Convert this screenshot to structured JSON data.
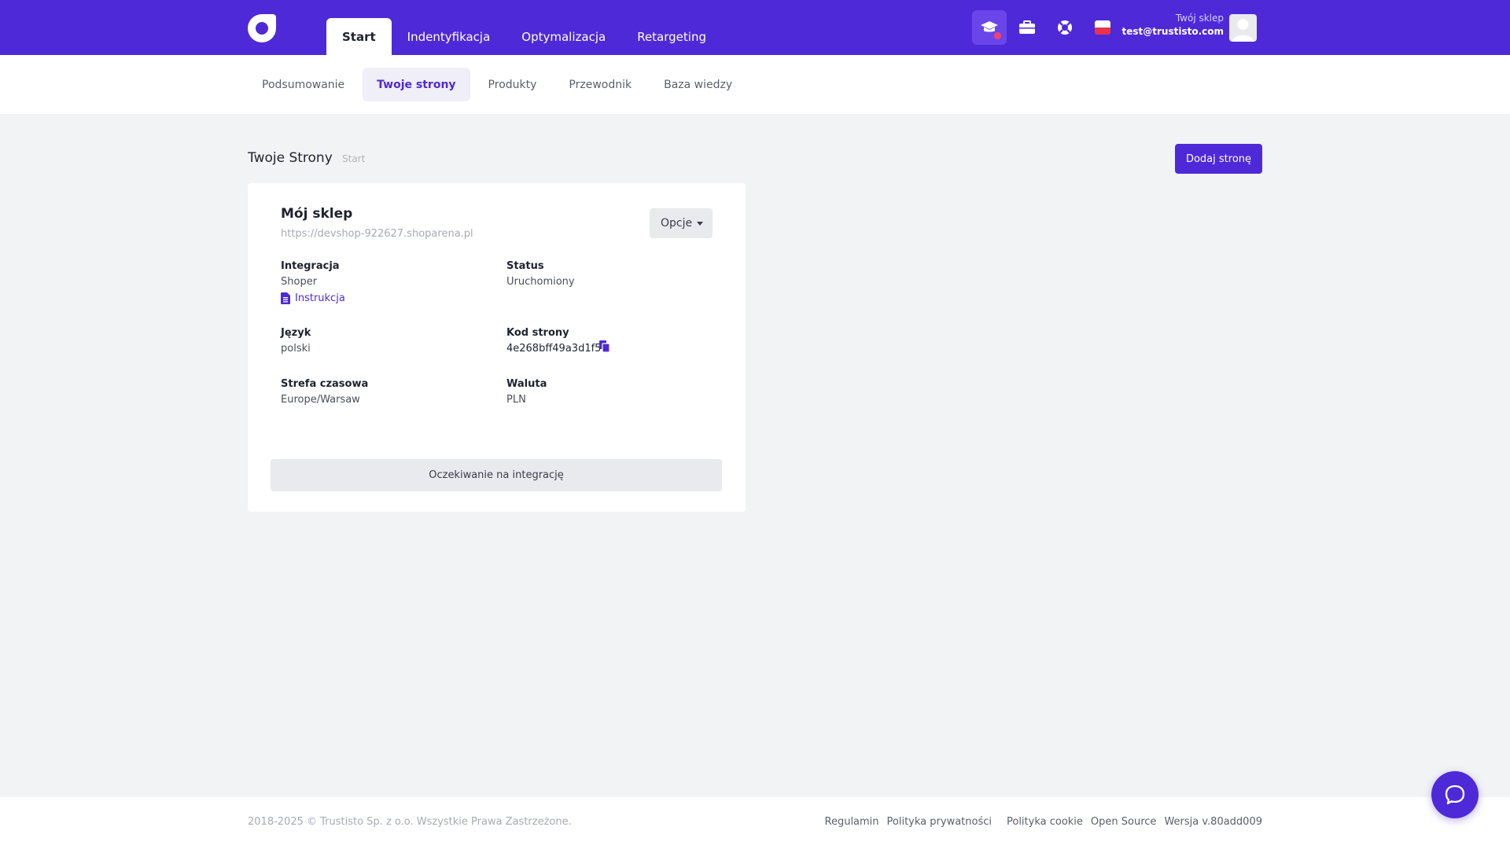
{
  "nav": {
    "tabs": [
      {
        "label": "Start"
      },
      {
        "label": "Indentyfikacja"
      },
      {
        "label": "Optymalizacja"
      },
      {
        "label": "Retargeting"
      }
    ],
    "icons": [
      "graduation-cap-icon",
      "briefcase-icon",
      "lifebuoy-icon",
      "flag-pl-icon"
    ],
    "account": {
      "shop_label": "Twój sklep",
      "email": "test@trustisto.com"
    }
  },
  "subnav": {
    "tabs": [
      {
        "label": "Podsumowanie"
      },
      {
        "label": "Twoje strony"
      },
      {
        "label": "Produkty"
      },
      {
        "label": "Przewodnik"
      },
      {
        "label": "Baza wiedzy"
      }
    ]
  },
  "page": {
    "title": "Twoje Strony",
    "breadcrumb": "Start",
    "add_button": "Dodaj stronę"
  },
  "card": {
    "title": "Mój sklep",
    "url": "https://devshop-922627.shoparena.pl",
    "options_label": "Opcje",
    "fields": {
      "integration_label": "Integracja",
      "integration_value": "Shoper",
      "instruction_link": "Instrukcja",
      "status_label": "Status",
      "status_value": "Uruchomiony",
      "language_label": "Język",
      "language_value": "polski",
      "code_label": "Kod strony",
      "code_value": "4e268bff49a3d1f5",
      "timezone_label": "Strefa czasowa",
      "timezone_value": "Europe/Warsaw",
      "currency_label": "Waluta",
      "currency_value": "PLN"
    },
    "await_label": "Oczekiwanie na integrację"
  },
  "footer": {
    "copyright": "2018-2025 © Trustisto Sp. z o.o. Wszystkie Prawa Zastrzeżone.",
    "links": [
      "Regulamin",
      "Polityka prywatności",
      "Polityka cookie",
      "Open Source",
      "Wersja v.80add009"
    ]
  },
  "colors": {
    "brand": "#4e29d8",
    "badge": "#f0436a"
  }
}
